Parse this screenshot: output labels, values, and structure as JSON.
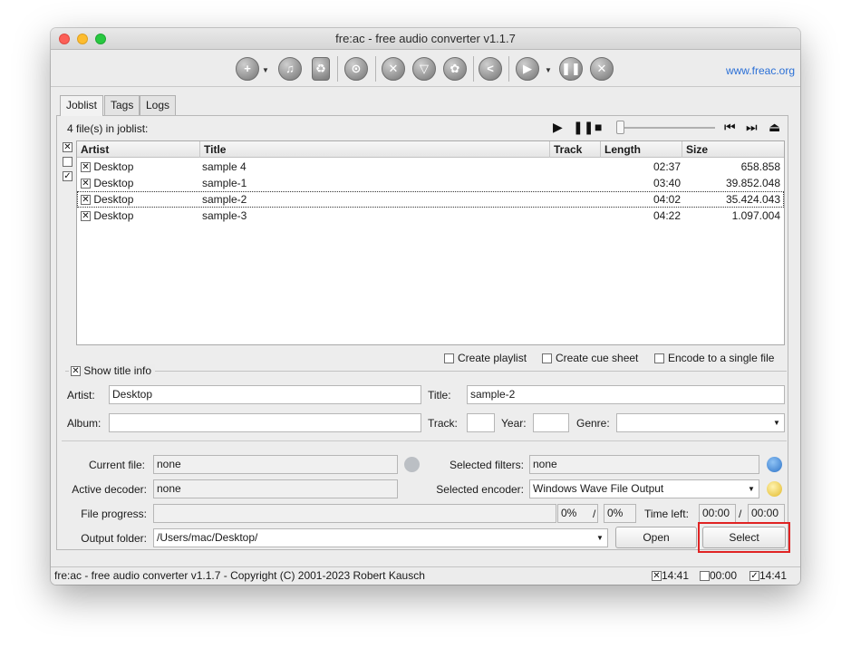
{
  "window": {
    "title": "fre:ac - free audio converter v1.1.7"
  },
  "toolbar": {
    "website": "www.freac.org",
    "icons": [
      "add-files-icon",
      "cd-audio-icon",
      "recycle-icon",
      "cddb-search-icon",
      "configure-icon",
      "filter-icon",
      "encoder-config-icon",
      "share-icon",
      "start-encoding-icon",
      "pause-icon",
      "stop-icon"
    ]
  },
  "tabs": [
    "Joblist",
    "Tags",
    "Logs"
  ],
  "joblist": {
    "count_label": "4 file(s) in joblist:",
    "columns": [
      "Artist",
      "Title",
      "Track",
      "Length",
      "Size"
    ],
    "rows": [
      {
        "artist": "Desktop",
        "title": "sample 4",
        "track": "",
        "length": "02:37",
        "size": "658.858",
        "checked": true
      },
      {
        "artist": "Desktop",
        "title": "sample-1",
        "track": "",
        "length": "03:40",
        "size": "39.852.048",
        "checked": true
      },
      {
        "artist": "Desktop",
        "title": "sample-2",
        "track": "",
        "length": "04:02",
        "size": "35.424.043",
        "checked": true,
        "selected": true
      },
      {
        "artist": "Desktop",
        "title": "sample-3",
        "track": "",
        "length": "04:22",
        "size": "1.097.004",
        "checked": true
      }
    ]
  },
  "options": {
    "create_playlist": "Create playlist",
    "create_cue_sheet": "Create cue sheet",
    "encode_single_file": "Encode to a single file"
  },
  "title_info": {
    "legend": "Show title info",
    "artist_label": "Artist:",
    "artist_value": "Desktop",
    "title_label": "Title:",
    "title_value": "sample-2",
    "album_label": "Album:",
    "album_value": "",
    "track_label": "Track:",
    "track_value": "",
    "year_label": "Year:",
    "year_value": "",
    "genre_label": "Genre:",
    "genre_value": ""
  },
  "progress": {
    "current_file_label": "Current file:",
    "current_file_value": "none",
    "selected_filters_label": "Selected filters:",
    "selected_filters_value": "none",
    "active_decoder_label": "Active decoder:",
    "active_decoder_value": "none",
    "selected_encoder_label": "Selected encoder:",
    "selected_encoder_value": "Windows Wave File Output",
    "file_progress_label": "File progress:",
    "file_percent": "0%",
    "separator": "/",
    "total_percent": "0%",
    "time_left_label": "Time left:",
    "time_left": "00:00",
    "time_total": "00:00",
    "output_folder_label": "Output folder:",
    "output_folder_value": "/Users/mac/Desktop/",
    "open_label": "Open",
    "select_label": "Select"
  },
  "status": {
    "copyright": "fre:ac - free audio converter v1.1.7 - Copyright (C) 2001-2023 Robert Kausch",
    "time1": "14:41",
    "time2": "00:00",
    "time3": "14:41"
  },
  "colors": {
    "highlight": "#e02323",
    "link": "#2a6fd6"
  }
}
